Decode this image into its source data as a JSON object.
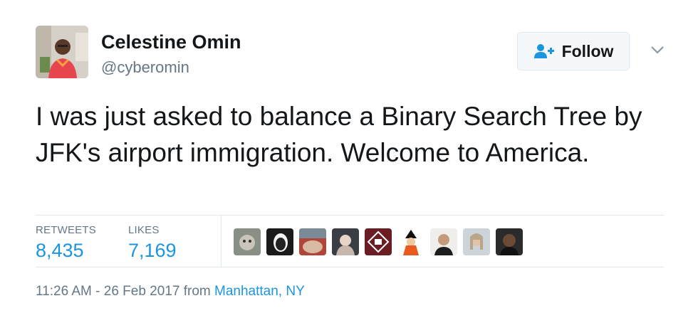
{
  "user": {
    "name": "Celestine Omin",
    "handle": "@cyberomin"
  },
  "follow_button": {
    "label": "Follow",
    "icon": "add-user-icon"
  },
  "menu": {
    "icon": "chevron-down-icon"
  },
  "tweet": {
    "text": "I was just asked to balance a Binary Search Tree by JFK's airport immigration. Welcome to America."
  },
  "stats": {
    "retweets_label": "RETWEETS",
    "retweets_count": "8,435",
    "likes_label": "LIKES",
    "likes_count": "7,169"
  },
  "likers_count": 9,
  "footer": {
    "timestamp": "11:26 AM - 26 Feb 2017",
    "from": "from",
    "location": "Manhattan, NY"
  },
  "colors": {
    "link": "#1b95e0",
    "secondary": "#657786",
    "border": "#e1e8ed"
  }
}
